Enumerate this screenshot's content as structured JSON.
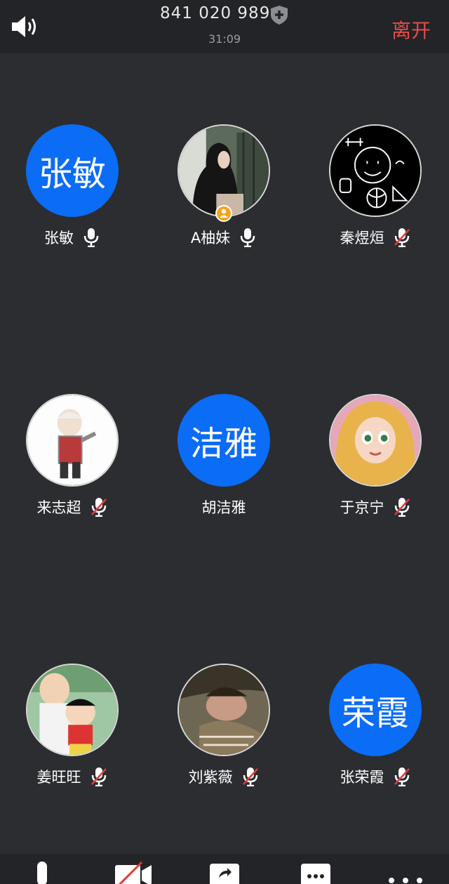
{
  "header": {
    "meeting_id": "841 020 989",
    "timer": "31:09",
    "leave_label": "离开"
  },
  "participants": [
    {
      "name": "张敏",
      "avatar_text": "张敏",
      "mic": "on"
    },
    {
      "name": "A柚妹",
      "mic": "on",
      "badge": "host-icon"
    },
    {
      "name": "秦煜烜",
      "mic": "muted"
    },
    {
      "name": "来志超",
      "mic": "muted"
    },
    {
      "name": "胡洁雅",
      "avatar_text": "洁雅",
      "mic": "none"
    },
    {
      "name": "于京宁",
      "mic": "muted"
    },
    {
      "name": "姜旺旺",
      "mic": "muted"
    },
    {
      "name": "刘紫薇",
      "mic": "muted"
    },
    {
      "name": "张荣霞",
      "avatar_text": "荣霞",
      "mic": "muted"
    }
  ],
  "colors": {
    "background": "#2b2d31",
    "bar": "#222427",
    "accent_blue": "#0b6cf5",
    "leave_red": "#e64b4b",
    "host_badge": "#f4a51b"
  }
}
